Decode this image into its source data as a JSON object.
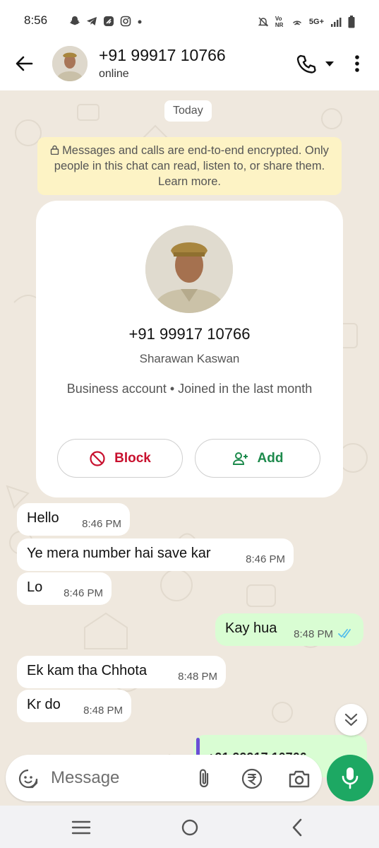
{
  "status_bar": {
    "time": "8:56",
    "network": "5G+",
    "volte": "Vo NR"
  },
  "header": {
    "contact_title": "+91 99917 10766",
    "status": "online"
  },
  "chat": {
    "day_chip": "Today",
    "encryption_notice": "Messages and calls are end-to-end encrypted. Only people in this chat can read, listen to, or share them. Learn more.",
    "contact_card": {
      "phone": "+91 99917 10766",
      "name": "Sharawan Kaswan",
      "info": "Business account • Joined in the last month",
      "block_label": "Block",
      "add_label": "Add"
    },
    "messages": [
      {
        "direction": "in",
        "text": "Hello",
        "time": "8:46 PM"
      },
      {
        "direction": "in",
        "text": "Ye mera number hai save kar",
        "time": "8:46 PM"
      },
      {
        "direction": "in",
        "text": "Lo",
        "time": "8:46 PM"
      },
      {
        "direction": "out",
        "text": "Kay hua",
        "time": "8:48 PM",
        "read": true
      },
      {
        "direction": "in",
        "text": "Ek kam tha Chhota",
        "time": "8:48 PM"
      },
      {
        "direction": "in",
        "text": "Kr do",
        "time": "8:48 PM"
      }
    ],
    "partial_message_text": "+91 99917 10766"
  },
  "composer": {
    "placeholder": "Message"
  },
  "colors": {
    "accent_green": "#1da863",
    "outgoing_bubble": "#d9fdd3",
    "block_red": "#c8102e",
    "add_green": "#1d8a4c",
    "notice_yellow": "#fdf3c5",
    "read_tick_blue": "#53bdeb"
  },
  "icons": [
    "back-arrow-icon",
    "call-icon",
    "dropdown-caret-icon",
    "more-vert-icon",
    "lock-icon",
    "block-icon",
    "add-person-icon",
    "double-tick-icon",
    "scroll-down-icon",
    "sticker-icon",
    "attach-icon",
    "rupee-icon",
    "camera-icon",
    "mic-icon"
  ]
}
